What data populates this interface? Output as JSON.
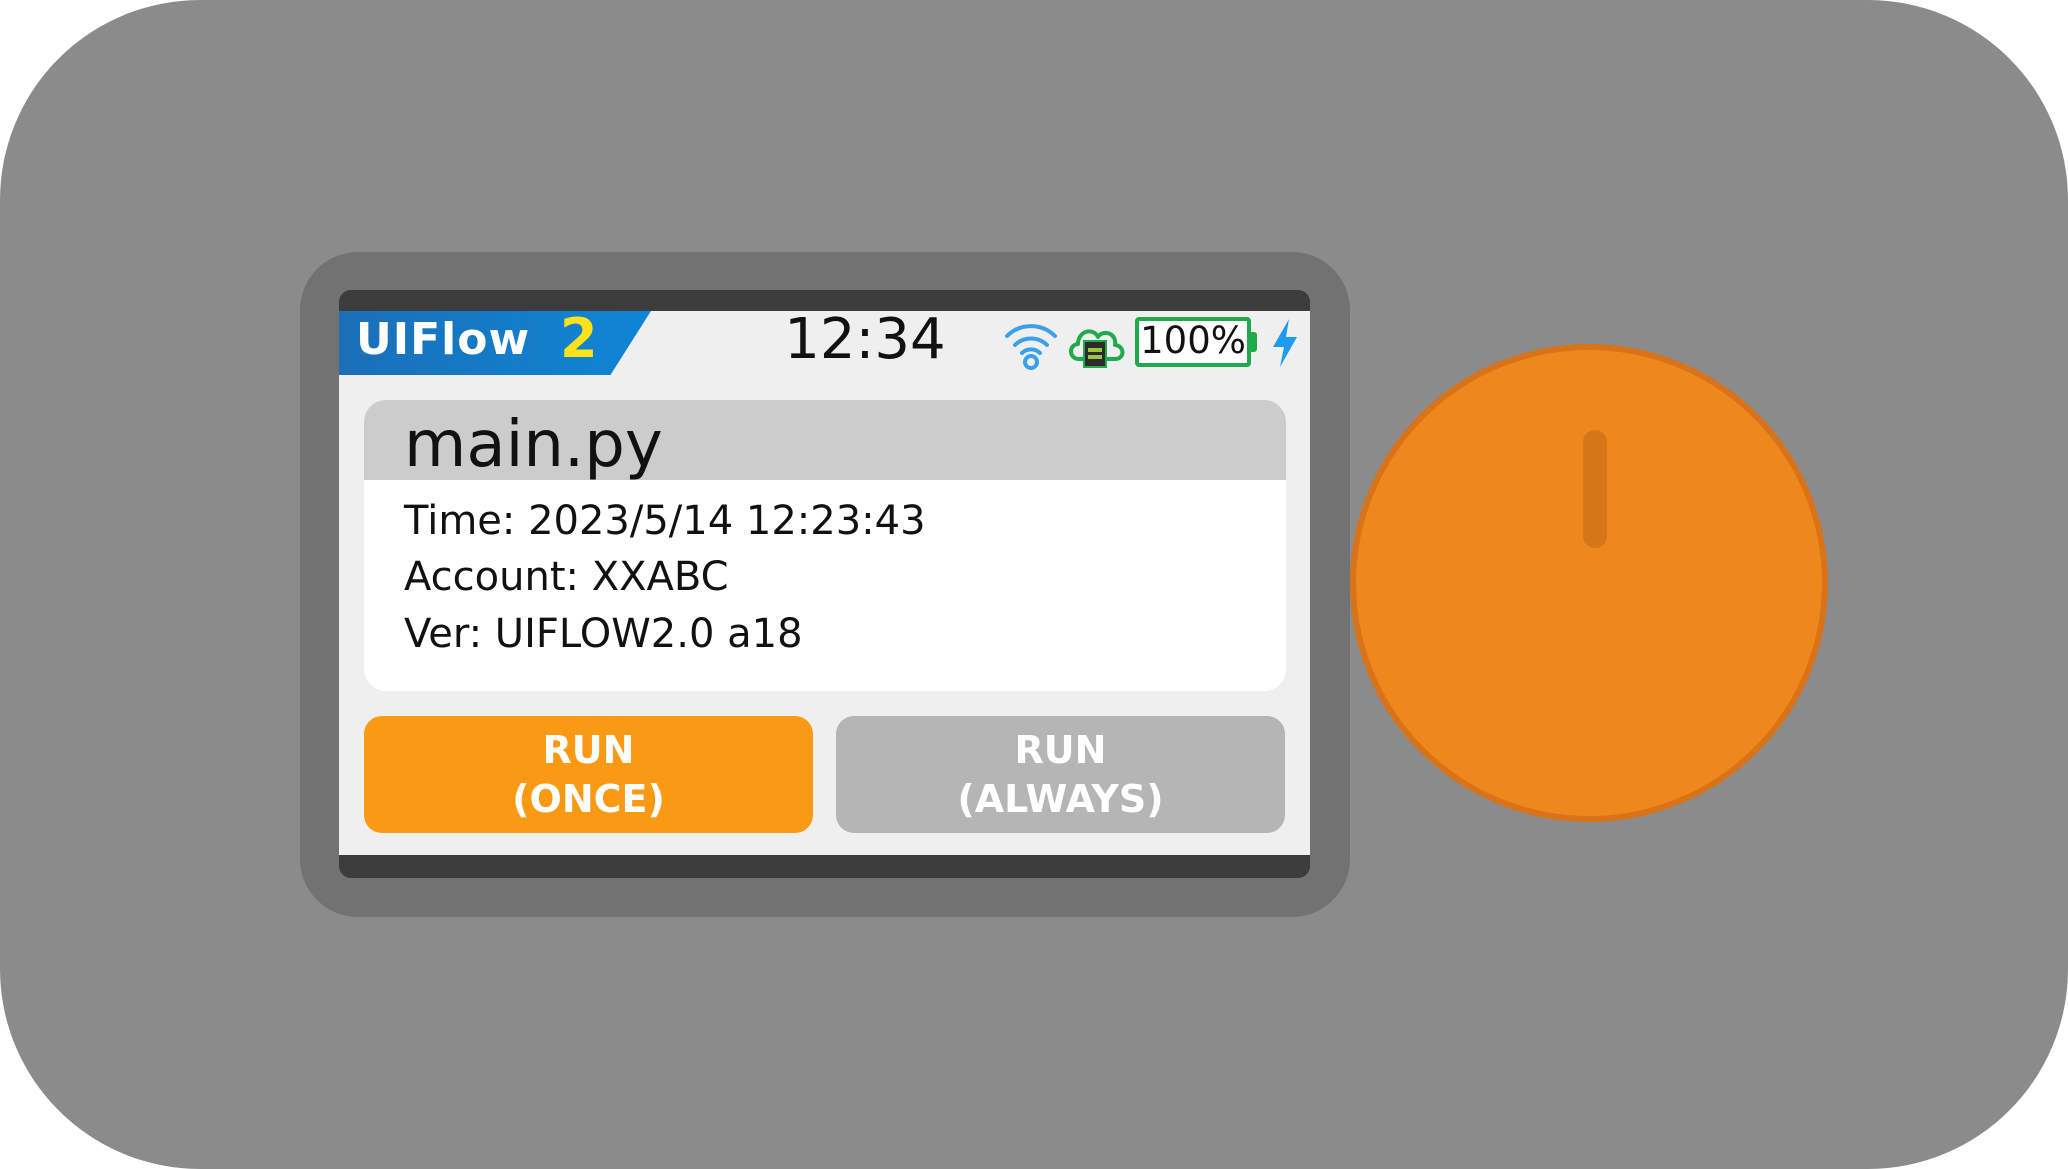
{
  "status_bar": {
    "logo_text": "UIFlow",
    "logo_number": "2",
    "clock": "12:34",
    "battery": "100%",
    "icons": [
      "wifi-icon",
      "cloud-icon",
      "battery-icon",
      "bolt-icon"
    ],
    "colors": {
      "wifi": "#3aa0e8",
      "cloud": "#1faa4b",
      "battery": "#1faa4b",
      "bolt": "#1e9bf0"
    }
  },
  "file_card": {
    "file_name": "main.py",
    "time": "Time: 2023/5/14 12:23:43",
    "account": "Account: XXABC",
    "version": "Ver: UIFLOW2.0 a18"
  },
  "buttons": {
    "run_once": {
      "line1": "RUN",
      "line2": "(ONCE)",
      "color": "#fa9a14"
    },
    "run_always": {
      "line1": "RUN",
      "line2": "(ALWAYS)",
      "color": "#b5b5b5"
    }
  },
  "device": {
    "body_color": "#8b8b8b",
    "knob_color": "#ee871c"
  }
}
